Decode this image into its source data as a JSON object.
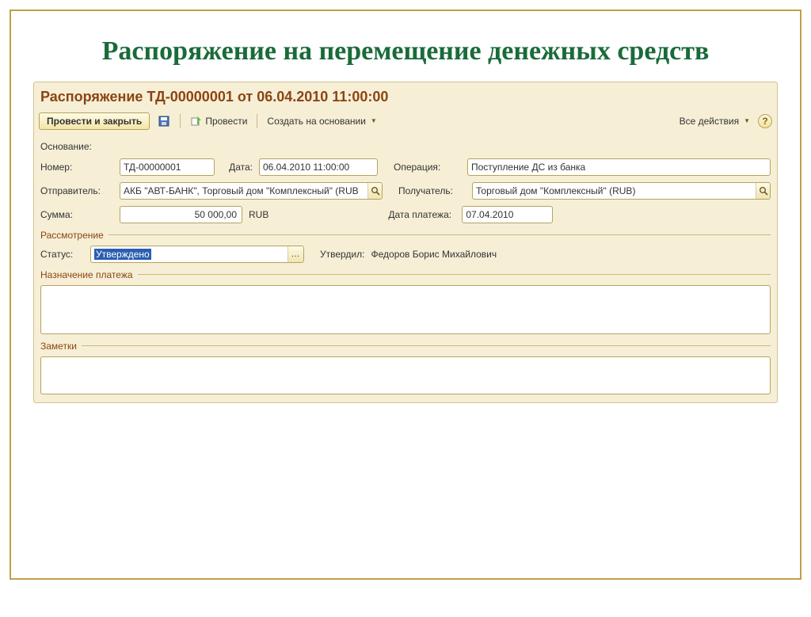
{
  "slide": {
    "title": "Распоряжение на перемещение денежных средств"
  },
  "header": {
    "doc_title": "Распоряжение ТД-00000001 от 06.04.2010 11:00:00"
  },
  "toolbar": {
    "submit_close": "Провести и закрыть",
    "submit": "Провести",
    "create_based": "Создать на основании",
    "all_actions": "Все действия",
    "help": "?"
  },
  "labels": {
    "basis": "Основание:",
    "number": "Номер:",
    "date": "Дата:",
    "operation": "Операция:",
    "sender": "Отправитель:",
    "recipient": "Получатель:",
    "amount": "Сумма:",
    "currency": "RUB",
    "payment_date": "Дата платежа:",
    "status": "Статус:",
    "approved_by_label": "Утвердил:",
    "group_review": "Рассмотрение",
    "group_purpose": "Назначение платежа",
    "group_notes": "Заметки"
  },
  "values": {
    "number": "ТД-00000001",
    "date": "06.04.2010 11:00:00",
    "operation": "Поступление ДС из банка",
    "sender": "АКБ \"АВТ-БАНК\", Торговый дом \"Комплексный\" (RUB",
    "recipient": "Торговый дом \"Комплексный\" (RUB)",
    "amount": "50 000,00",
    "payment_date": "07.04.2010",
    "status": "Утверждено",
    "approved_by": "Федоров Борис Михайлович"
  }
}
